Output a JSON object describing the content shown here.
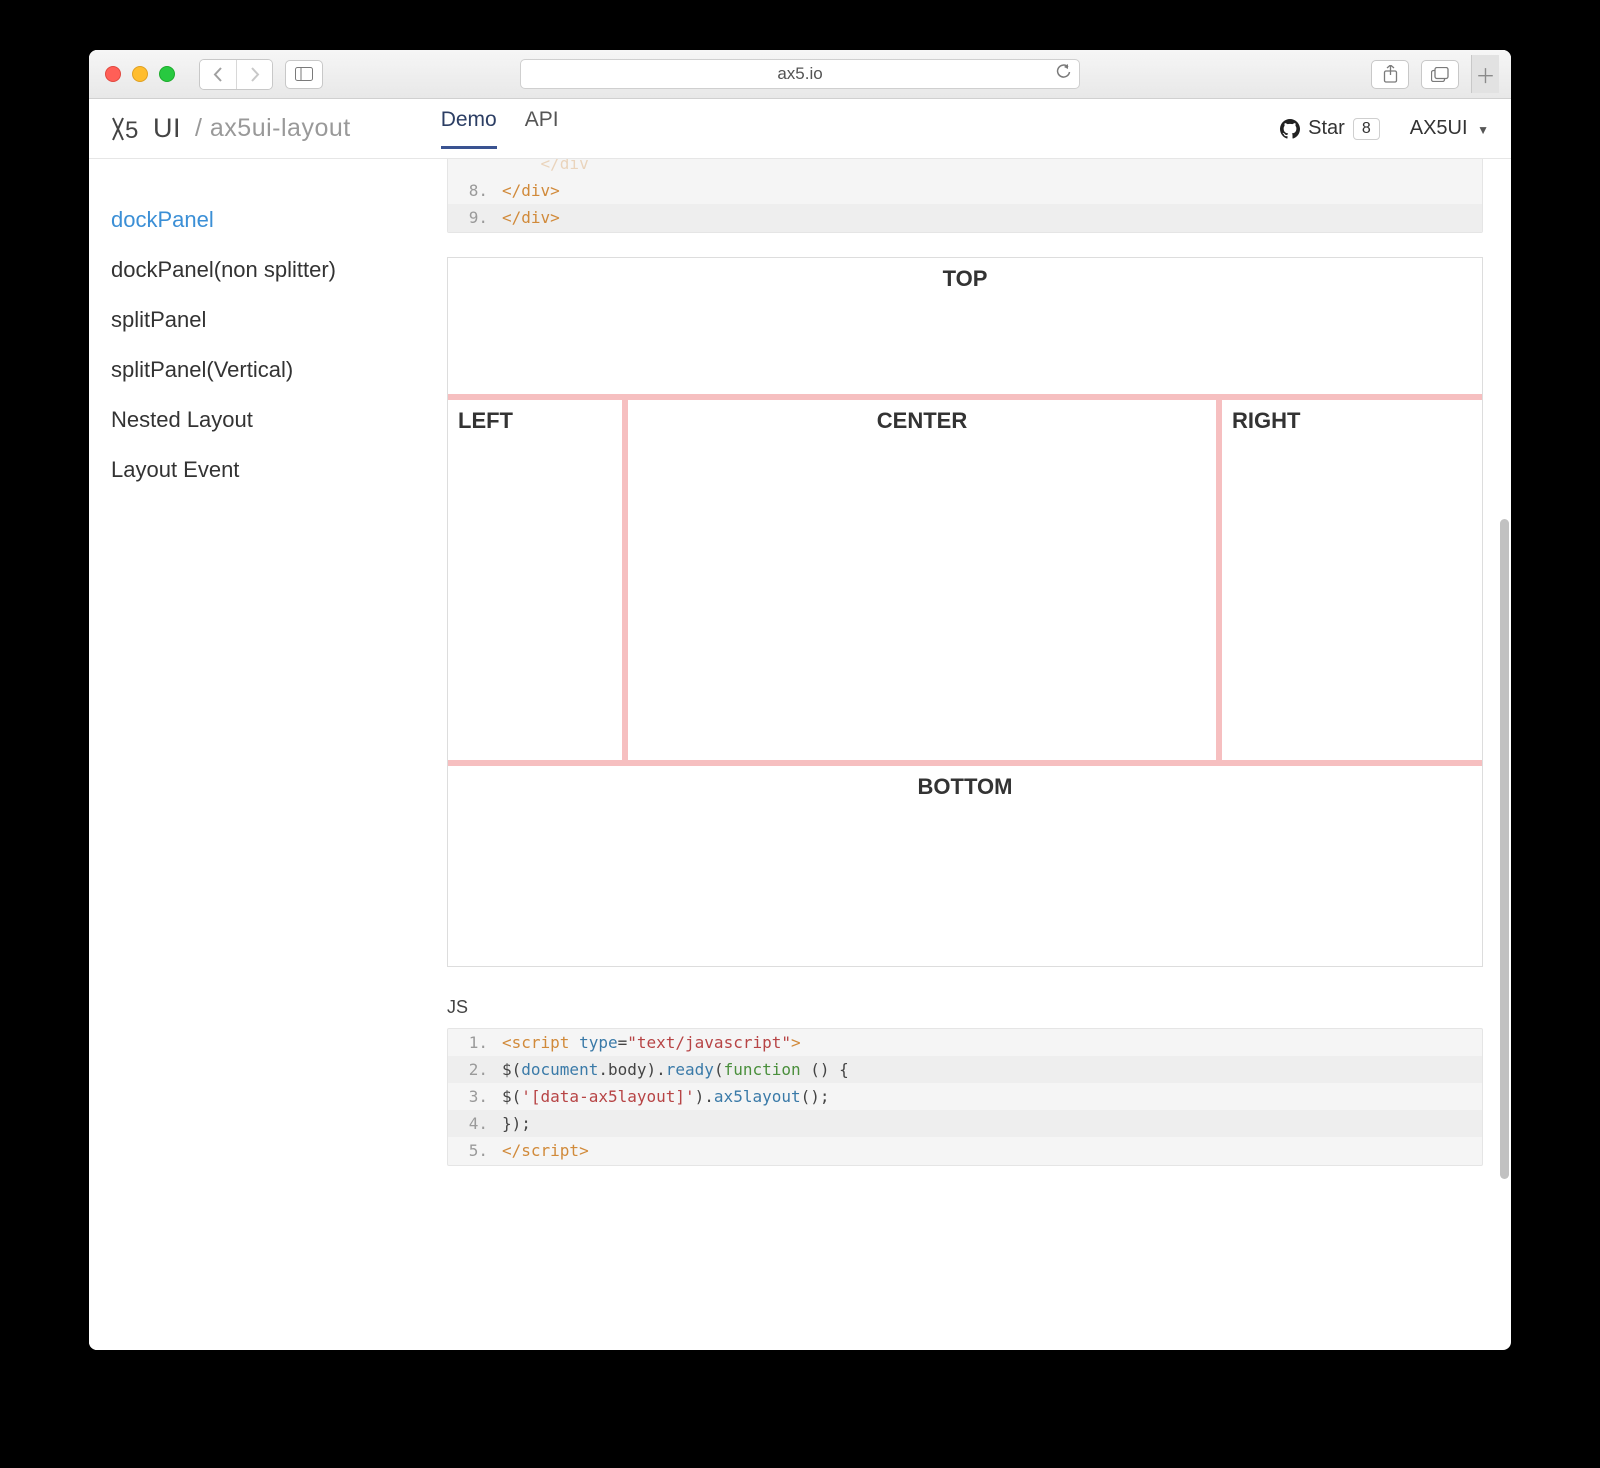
{
  "browser": {
    "url": "ax5.io"
  },
  "header": {
    "brand": "AX5UI",
    "breadcrumb": "/ ax5ui-layout",
    "tabs": [
      {
        "label": "Demo",
        "active": true
      },
      {
        "label": "API",
        "active": false
      }
    ],
    "github": {
      "label": "Star",
      "count": "8"
    },
    "menu_label": "AX5UI"
  },
  "sidebar": {
    "items": [
      {
        "label": "dockPanel",
        "active": true
      },
      {
        "label": "dockPanel(non splitter)",
        "active": false
      },
      {
        "label": "splitPanel",
        "active": false
      },
      {
        "label": "splitPanel(Vertical)",
        "active": false
      },
      {
        "label": "Nested Layout",
        "active": false
      },
      {
        "label": "Layout Event",
        "active": false
      }
    ]
  },
  "code_html": {
    "lines": [
      {
        "n": "8.",
        "span": "    </div>",
        "stripe": false,
        "partial_above": true
      },
      {
        "n": "9.",
        "span": "</div>",
        "stripe": true
      }
    ]
  },
  "layout": {
    "top": "TOP",
    "left": "LEFT",
    "center": "CENTER",
    "right": "RIGHT",
    "bottom": "BOTTOM"
  },
  "js_label": "JS",
  "code_js": {
    "lines": [
      {
        "n": "1.",
        "tokens": [
          {
            "t": "<script ",
            "c": "t-tag"
          },
          {
            "t": "type",
            "c": "t-attr"
          },
          {
            "t": "=",
            "c": "t-plain"
          },
          {
            "t": "\"text/javascript\"",
            "c": "t-str"
          },
          {
            "t": ">",
            "c": "t-tag"
          }
        ]
      },
      {
        "n": "2.",
        "tokens": [
          {
            "t": "    $(",
            "c": "t-plain"
          },
          {
            "t": "document",
            "c": "t-attr"
          },
          {
            "t": ".body).",
            "c": "t-plain"
          },
          {
            "t": "ready",
            "c": "t-attr"
          },
          {
            "t": "(",
            "c": "t-plain"
          },
          {
            "t": "function ",
            "c": "t-fn"
          },
          {
            "t": "() {",
            "c": "t-plain"
          }
        ]
      },
      {
        "n": "3.",
        "tokens": [
          {
            "t": "        $(",
            "c": "t-plain"
          },
          {
            "t": "'[data-ax5layout]'",
            "c": "t-str"
          },
          {
            "t": ").",
            "c": "t-plain"
          },
          {
            "t": "ax5layout",
            "c": "t-attr"
          },
          {
            "t": "();",
            "c": "t-plain"
          }
        ]
      },
      {
        "n": "4.",
        "tokens": [
          {
            "t": "    });",
            "c": "t-plain"
          }
        ]
      },
      {
        "n": "5.",
        "tokens": [
          {
            "t": "</script",
            "c": "t-tag"
          },
          {
            "t": ">",
            "c": "t-tag"
          }
        ]
      }
    ]
  }
}
